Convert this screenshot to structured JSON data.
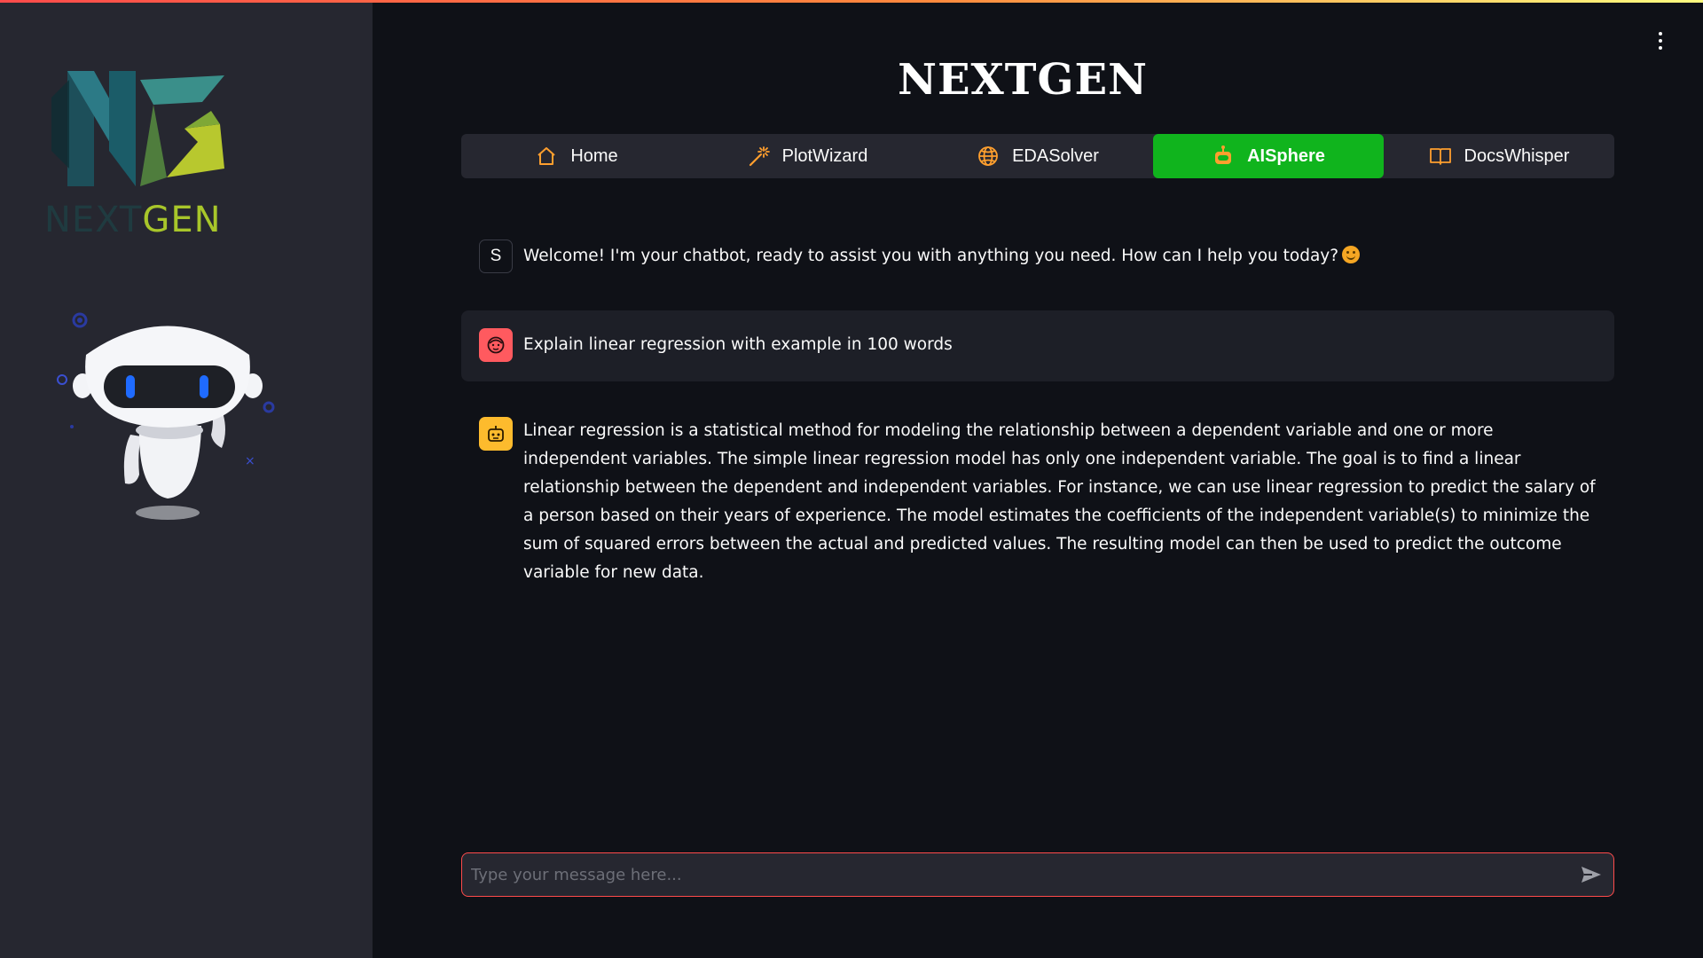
{
  "app": {
    "title": "NEXTGEN"
  },
  "sidebar": {
    "logo": {
      "text_dim": "NEXT",
      "text_lit": "GEN"
    },
    "illustration": "robot-illustration"
  },
  "header": {
    "menu_icon": "kebab-menu-icon"
  },
  "nav": {
    "items": [
      {
        "label": "Home",
        "icon": "home-icon",
        "active": false
      },
      {
        "label": "PlotWizard",
        "icon": "magic-wand-icon",
        "active": false
      },
      {
        "label": "EDASolver",
        "icon": "globe-icon",
        "active": false
      },
      {
        "label": "AISphere",
        "icon": "robot-icon",
        "active": true
      },
      {
        "label": "DocsWhisper",
        "icon": "book-icon",
        "active": false
      }
    ]
  },
  "chat": {
    "messages": [
      {
        "role": "system",
        "avatar": "S",
        "text": "Welcome! I'm your chatbot, ready to assist you with anything you need. How can I help you today?",
        "emoji": "smiling-face-emoji"
      },
      {
        "role": "user",
        "avatar": "user-face-icon",
        "text": "Explain linear regression with example in 100 words"
      },
      {
        "role": "assistant",
        "avatar": "bot-face-icon",
        "text": "Linear regression is a statistical method for modeling the relationship between a dependent variable and one or more independent variables. The simple linear regression model has only one independent variable. The goal is to find a linear relationship between the dependent and independent variables. For instance, we can use linear regression to predict the salary of a person based on their years of experience. The model estimates the coefficients of the independent variable(s) to minimize the sum of squared errors between the actual and predicted values. The resulting model can then be used to predict the outcome variable for new data."
      }
    ],
    "input": {
      "placeholder": "Type your message here...",
      "value": ""
    },
    "send_icon": "send-icon"
  },
  "colors": {
    "background": "#0f1117",
    "sidebar": "#262730",
    "accent_active": "#10b41d",
    "input_border": "#ff4b4b",
    "user_avatar": "#ff5a5f",
    "bot_avatar": "#fdbb2d"
  }
}
